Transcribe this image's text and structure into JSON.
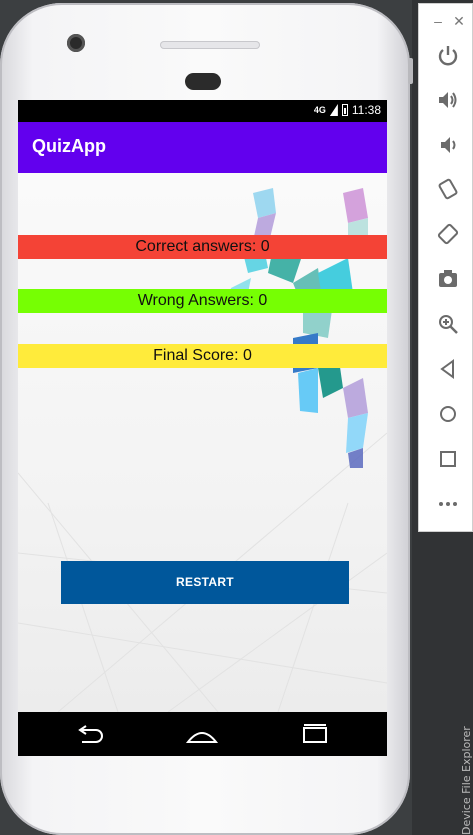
{
  "status_bar": {
    "network": "4G",
    "time": "11:38"
  },
  "app_bar": {
    "title": "QuizApp"
  },
  "results": {
    "correct": "Correct answers: 0",
    "wrong": "Wrong Answers: 0",
    "final": "Final Score: 0"
  },
  "restart_button": {
    "label": "RESTART"
  },
  "ide": {
    "side_text": "Device File Explorer",
    "tab_hint": "D"
  },
  "emulator_toolbar": {
    "window_controls": [
      "minimize-icon",
      "close-icon"
    ],
    "items": [
      "power-icon",
      "volume-up-icon",
      "volume-down-icon",
      "rotate-left-icon",
      "rotate-right-icon",
      "camera-icon",
      "zoom-icon",
      "back-icon",
      "home-icon",
      "overview-icon",
      "more-icon"
    ]
  },
  "colors": {
    "app_bar": "#6200ee",
    "correct": "#f44336",
    "wrong": "#76ff03",
    "final": "#ffeb3b",
    "restart": "#00579b"
  }
}
